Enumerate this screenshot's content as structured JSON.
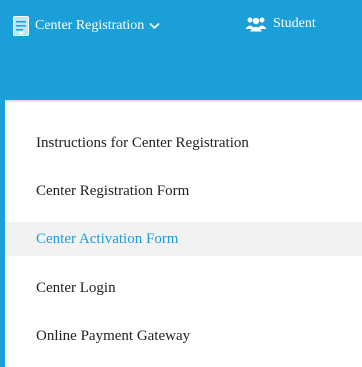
{
  "navbar": {
    "items": [
      {
        "label": "Center Registration",
        "icon": "form-document-icon"
      },
      {
        "label": "Student",
        "icon": "users-group-icon"
      }
    ]
  },
  "dropdown": {
    "items": [
      {
        "label": "Instructions for Center Registration",
        "active": false
      },
      {
        "label": "Center Registration Form",
        "active": false
      },
      {
        "label": "Center Activation Form",
        "active": true
      },
      {
        "label": "Center Login",
        "active": false
      },
      {
        "label": "Online Payment Gateway",
        "active": false
      }
    ]
  },
  "colors": {
    "brand": "#1a9fd9",
    "active_text": "#1a9fd9",
    "active_bg": "#f2f2f2",
    "text": "#222222"
  }
}
